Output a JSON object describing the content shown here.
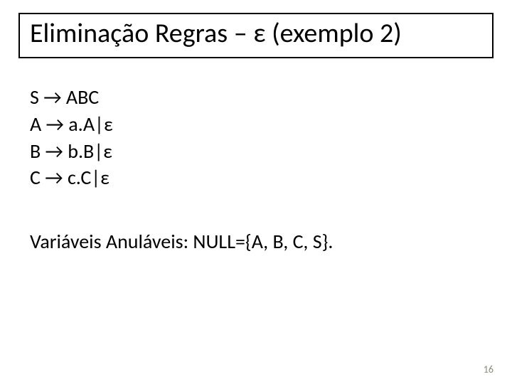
{
  "title": "Eliminação Regras – ε (exemplo 2)",
  "rules": [
    "S → ABC",
    "A → a.A|ε",
    "B → b.B|ε",
    "C → c.C|ε"
  ],
  "nullable_line": "Variáveis Anuláveis: NULL={A, B, C, S}.",
  "page_number": "16"
}
